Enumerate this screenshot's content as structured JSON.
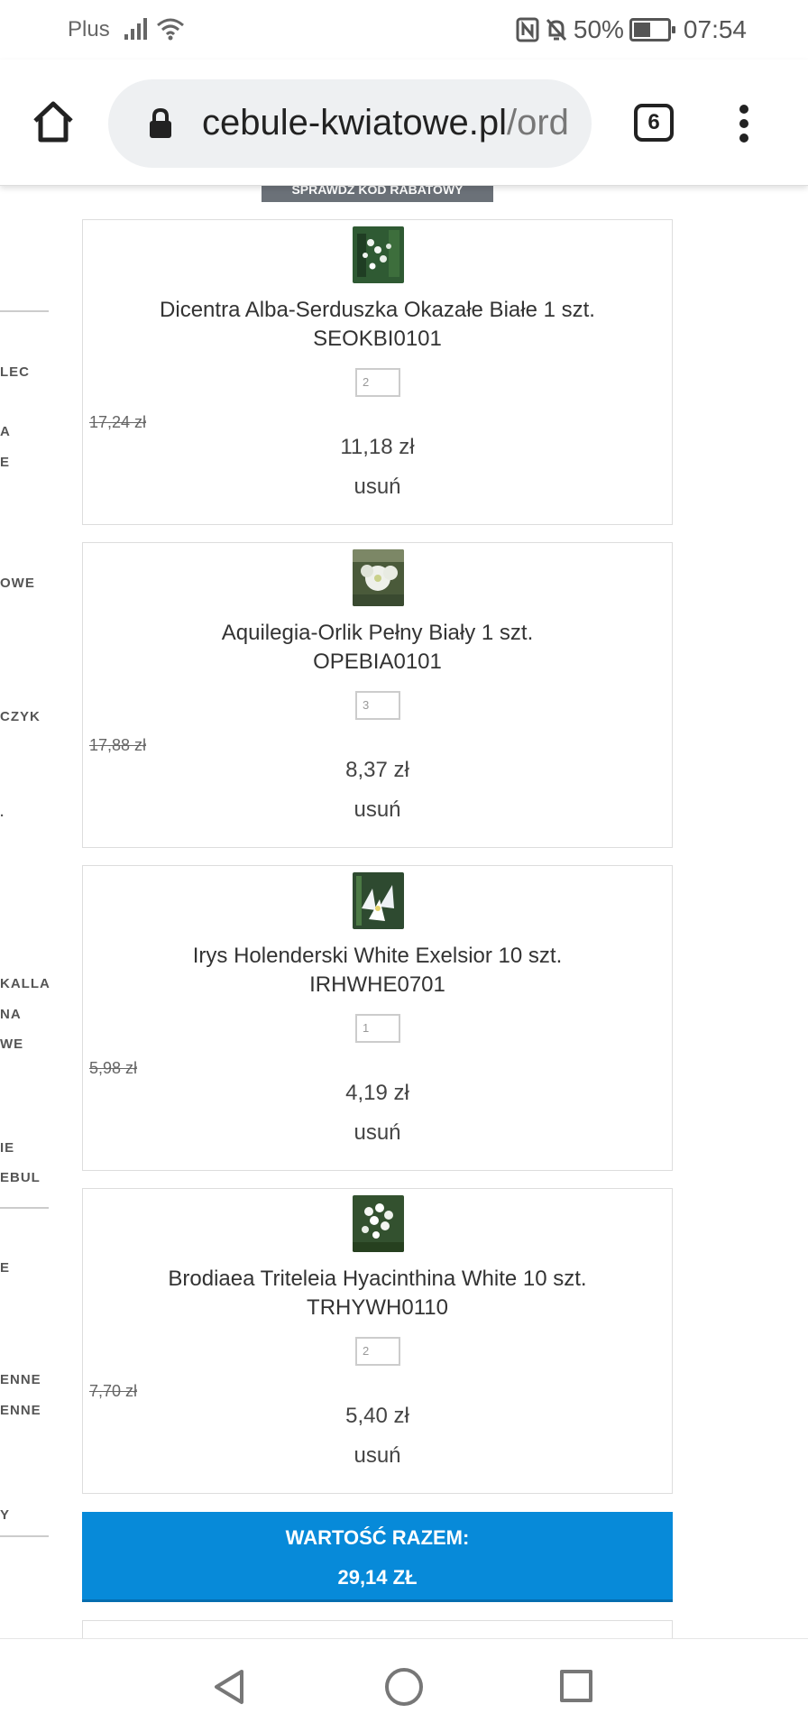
{
  "status_bar": {
    "carrier": "Plus",
    "battery_pct": "50%",
    "battery_level": 0.5,
    "time": "07:54",
    "icons": [
      "signal-icon",
      "wifi-icon",
      "nfc-icon",
      "bell-muted-icon",
      "battery-icon"
    ]
  },
  "browser": {
    "url_host": "cebule-kwiatowe.pl",
    "url_path": "/ord",
    "tab_count": "6",
    "icons": [
      "home-icon",
      "lock-icon",
      "tabs-icon",
      "more-menu-icon"
    ]
  },
  "discount_button": {
    "label": "SPRAWDŹ KOD RABATOWY"
  },
  "sidebar": {
    "items": [
      "LEC",
      "A",
      "E",
      "OWE",
      "CZYK",
      ".",
      "KALLA",
      "NA",
      "WE",
      "IE",
      "EBUL",
      "E",
      "ENNE",
      "ENNE",
      "Y"
    ]
  },
  "cart": {
    "items": [
      {
        "name": "Dicentra Alba-Serduszka Okazałe Białe 1 szt.",
        "code": "SEOKBI0101",
        "qty": "2",
        "old_price": "17,24 zł",
        "price": "11,18 zł",
        "remove": "usuń"
      },
      {
        "name": "Aquilegia-Orlik Pełny Biały 1 szt.",
        "code": "OPEBIA0101",
        "qty": "3",
        "old_price": "17,88 zł",
        "price": "8,37 zł",
        "remove": "usuń"
      },
      {
        "name": "Irys Holenderski White Exelsior 10 szt.",
        "code": "IRHWHE0701",
        "qty": "1",
        "old_price": "5,98 zł",
        "price": "4,19 zł",
        "remove": "usuń"
      },
      {
        "name": "Brodiaea Triteleia Hyacinthina White 10 szt.",
        "code": "TRHYWH0110",
        "qty": "2",
        "old_price": "7,70 zł",
        "price": "5,40 zł",
        "remove": "usuń"
      }
    ],
    "total_label": "WARTOŚĆ RAZEM:",
    "total_value": "29,14 ZŁ"
  },
  "colors": {
    "accent": "#078ad9",
    "discount_button_bg": "#6b7178"
  },
  "nav_bar": {
    "icons": [
      "back-icon",
      "home-circle-icon",
      "recent-apps-icon"
    ]
  }
}
